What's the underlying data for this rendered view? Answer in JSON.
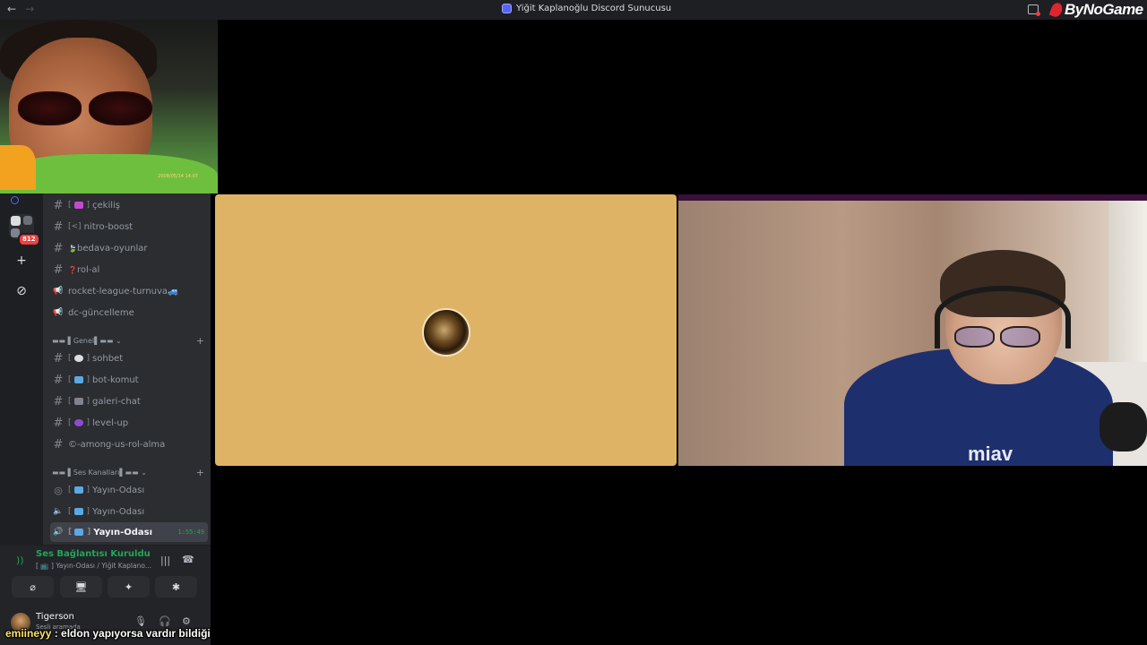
{
  "window": {
    "title": "Yiğit Kaplanoğlu Discord Sunucusu",
    "back_icon": "←",
    "forward_icon": "→",
    "brand": "ByNoGame"
  },
  "webcam": {
    "timestamp": "2008/05/14 14:07"
  },
  "rail": {
    "badge": "812",
    "add_icon": "+",
    "explore_icon": "⊘"
  },
  "channels": {
    "top": [
      {
        "icon": "#",
        "bracket": "[",
        "name": "çekiliş",
        "emoji_color": "#c04bd0"
      },
      {
        "icon": "#",
        "bracket": "[<]",
        "name": "nitro-boost"
      },
      {
        "icon": "#",
        "name": "bedava-oyunlar",
        "prefix": "🍃"
      },
      {
        "icon": "#",
        "name": "rol-al",
        "prefix": "❓"
      },
      {
        "icon": "📢",
        "name": "rocket-league-turnuva🚙"
      },
      {
        "icon": "📢",
        "name": "dc-güncelleme"
      }
    ],
    "cat_genel": "Genel",
    "genel": [
      {
        "icon": "#",
        "name": "sohbet",
        "emoji_color": "#dbdee1"
      },
      {
        "icon": "#",
        "name": "bot-komut",
        "emoji_color": "#5aa9e6"
      },
      {
        "icon": "#",
        "name": "galeri-chat",
        "emoji_color": "#80848e"
      },
      {
        "icon": "#",
        "name": "level-up",
        "emoji_color": "#8e4bd0"
      },
      {
        "icon": "#",
        "name": "©-among-us-rol-alma"
      }
    ],
    "cat_ses": "Ses Kanalları",
    "ses": [
      {
        "icon": "◎",
        "name": "Yayın-Odası",
        "emoji_color": "#5aa9e6"
      },
      {
        "icon": "🔈",
        "name": "Yayın-Odası",
        "emoji_color": "#5aa9e6"
      },
      {
        "icon": "🔊",
        "name": "Yayın-Odası",
        "emoji_color": "#5aa9e6",
        "timer": "1:55:49"
      }
    ]
  },
  "voice": {
    "status": "Ses Bağlantısı Kuruldu",
    "sub": "[ 📺 ]  Yayın-Odası / Yiğit Kaplano...",
    "signal_icon": "))",
    "noise_icon": "|||",
    "hangup_icon": "☎",
    "buttons": [
      "⌀",
      "🖥",
      "✦",
      "✱"
    ]
  },
  "user": {
    "name": "Tigerson",
    "status": "Sesli aramada",
    "mic_icon": "🎙",
    "headset_icon": "🎧",
    "settings_icon": "⚙"
  },
  "chat": {
    "nick": "emiineyy",
    "message": ": eldon yapıyorsa vardır bildiği"
  },
  "tiles": {
    "right_shirt_text": "miav"
  },
  "colors": {
    "accent": "#5865f2",
    "connected_green": "#23a55a",
    "tile_bg": "#dfb366",
    "badge_red": "#f23f43"
  }
}
